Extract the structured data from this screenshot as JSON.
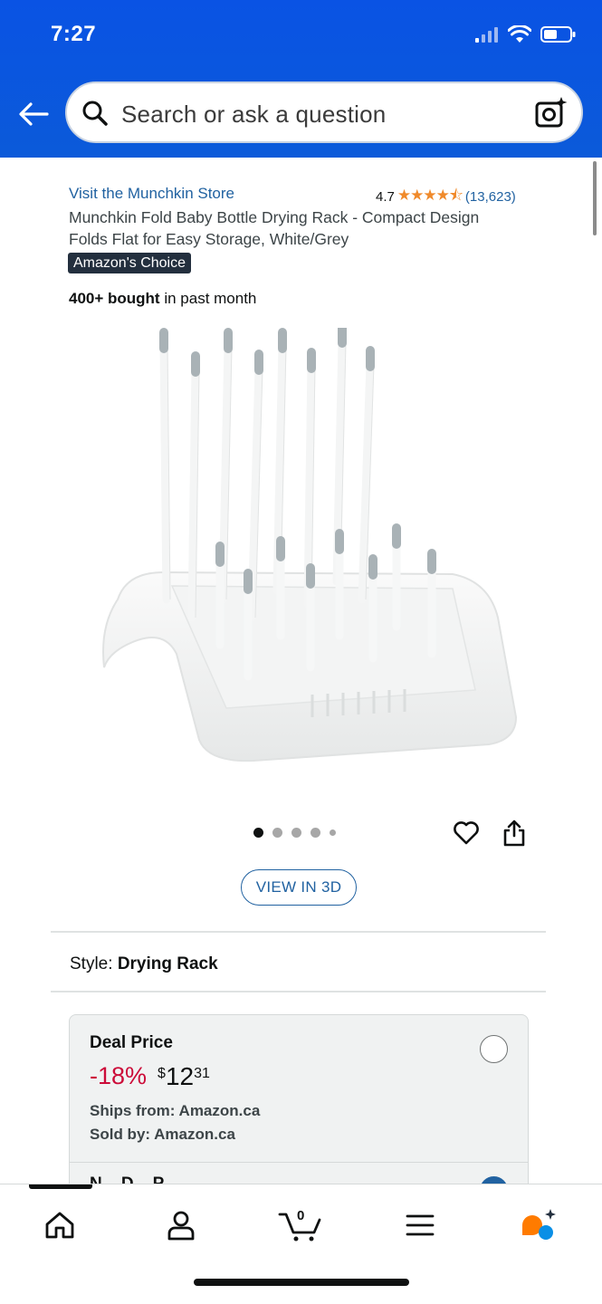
{
  "status_bar": {
    "time": "7:27"
  },
  "search": {
    "placeholder": "Search or ask a question"
  },
  "product": {
    "store_link": "Visit the Munchkin Store",
    "rating": "4.7",
    "stars": "★★★★⯪",
    "rating_count": "(13,623)",
    "title": "Munchkin Fold Baby Bottle Drying Rack - Compact Design Folds Flat for Easy Storage, White/Grey",
    "badge": "Amazon's Choice",
    "bought_bold": "400+ bought",
    "bought_rest": " in past month",
    "image_count": 5,
    "view_3d": "VIEW IN 3D"
  },
  "style": {
    "label": "Style:",
    "value": "Drying Rack"
  },
  "deal": {
    "title": "Deal Price",
    "discount": "-18%",
    "currency": "$",
    "price_whole": "12",
    "price_fraction": "31",
    "ships_from": "Ships from: Amazon.ca",
    "sold_by": "Sold by: Amazon.ca",
    "next_option_partial": "N... D... P...",
    "selected": false
  },
  "bottom_nav": {
    "items": [
      "home-icon",
      "account-icon",
      "cart-icon",
      "menu-icon",
      "rufus-icon"
    ],
    "cart_count": "0",
    "accent": "#ff7b00",
    "rufus_blue": "#0a8fe6"
  },
  "colors": {
    "header_blue": "#0a53e4",
    "link_blue": "#2162a1",
    "discount_red": "#cc0c39",
    "star_orange": "#f08a2b"
  }
}
